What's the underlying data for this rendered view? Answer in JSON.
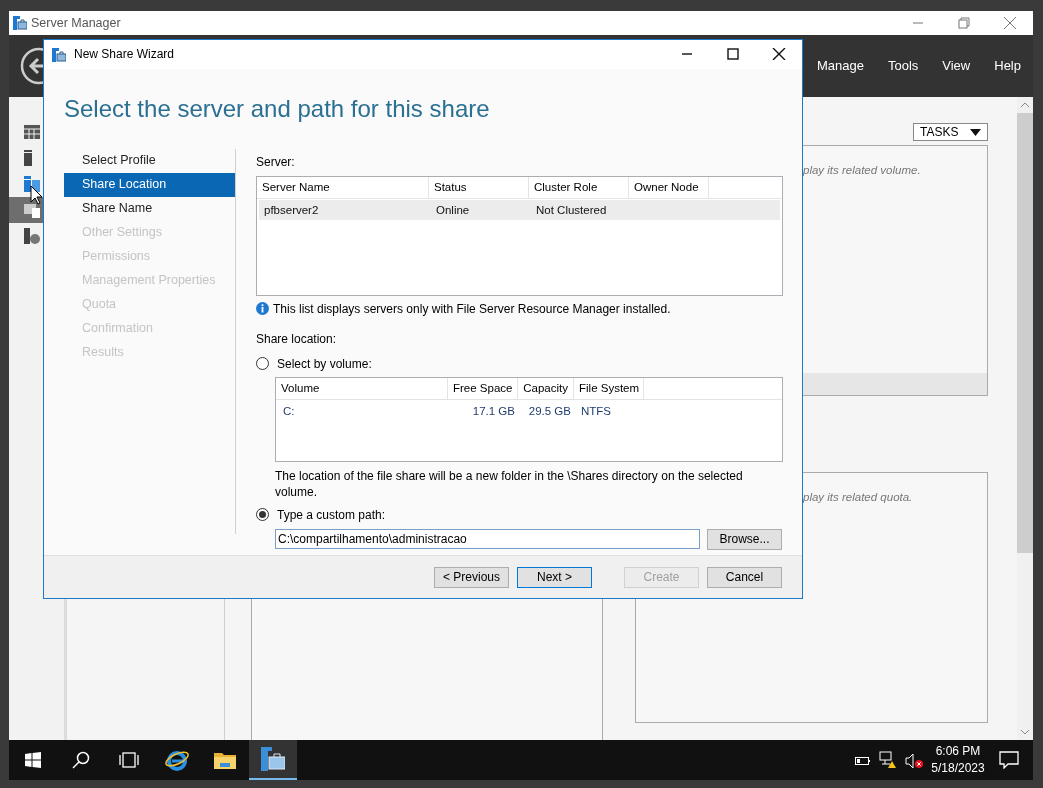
{
  "server_manager": {
    "title": "Server Manager",
    "menu": [
      "Manage",
      "Tools",
      "View",
      "Help"
    ],
    "nav_icons": [
      {
        "kind": "dashboard",
        "selected": false
      },
      {
        "kind": "local-server",
        "selected": false
      },
      {
        "kind": "all-servers",
        "selected": false
      },
      {
        "kind": "file-storage",
        "selected": true
      },
      {
        "kind": "iis",
        "selected": false
      }
    ],
    "tasks_button": "TASKS",
    "volume_hint": "play its related volume.",
    "quota_hint": "play its related quota."
  },
  "wizard": {
    "title": "New Share Wizard",
    "heading": "Select the server and path for this share",
    "steps": [
      {
        "label": "Select Profile",
        "selected": false,
        "disabled": false
      },
      {
        "label": "Share Location",
        "selected": true,
        "disabled": false
      },
      {
        "label": "Share Name",
        "selected": false,
        "disabled": false
      },
      {
        "label": "Other Settings",
        "selected": false,
        "disabled": true
      },
      {
        "label": "Permissions",
        "selected": false,
        "disabled": true
      },
      {
        "label": "Management Properties",
        "selected": false,
        "disabled": true
      },
      {
        "label": "Quota",
        "selected": false,
        "disabled": true
      },
      {
        "label": "Confirmation",
        "selected": false,
        "disabled": true
      },
      {
        "label": "Results",
        "selected": false,
        "disabled": true
      }
    ],
    "server_label": "Server:",
    "server_table": {
      "columns": [
        "Server Name",
        "Status",
        "Cluster Role",
        "Owner Node"
      ],
      "rows": [
        {
          "cells": [
            "pfbserver2",
            "Online",
            "Not Clustered"
          ],
          "selected": true
        }
      ]
    },
    "info_note": "This list displays servers only with File Server Resource Manager installed.",
    "share_location_label": "Share location:",
    "options": [
      {
        "label": "Select by volume:",
        "selected": false
      },
      {
        "label": "Type a custom path:",
        "selected": true
      }
    ],
    "volume_table": {
      "columns": [
        "Volume",
        "Free Space",
        "Capacity",
        "File System"
      ],
      "rows": [
        {
          "cells": [
            "C:",
            "17.1 GB",
            "29.5 GB",
            "NTFS"
          ],
          "selected": false
        }
      ]
    },
    "volume_note": "The location of the file share will be a new folder in the \\Shares directory on the selected volume.",
    "custom_path": {
      "value": "C:\\compartilhamento\\administracao"
    },
    "browse_button": "Browse...",
    "buttons": [
      {
        "label": "< Previous",
        "disabled": false,
        "default": false
      },
      {
        "label": "Next >",
        "disabled": false,
        "default": true
      },
      {
        "label": "Create",
        "disabled": true,
        "default": false
      },
      {
        "label": "Cancel",
        "disabled": false,
        "default": false
      }
    ]
  },
  "taskbar": {
    "items": [
      {
        "kind": "start",
        "active": false
      },
      {
        "kind": "search",
        "active": false
      },
      {
        "kind": "task-view",
        "active": false
      },
      {
        "kind": "browser",
        "active": false
      },
      {
        "kind": "file-explorer",
        "active": false
      },
      {
        "kind": "server-manager",
        "active": true
      }
    ],
    "tray": [
      {
        "kind": "battery"
      },
      {
        "kind": "network-warning"
      },
      {
        "kind": "volume-muted"
      }
    ],
    "time": "6:06 PM",
    "date": "5/18/2023"
  }
}
